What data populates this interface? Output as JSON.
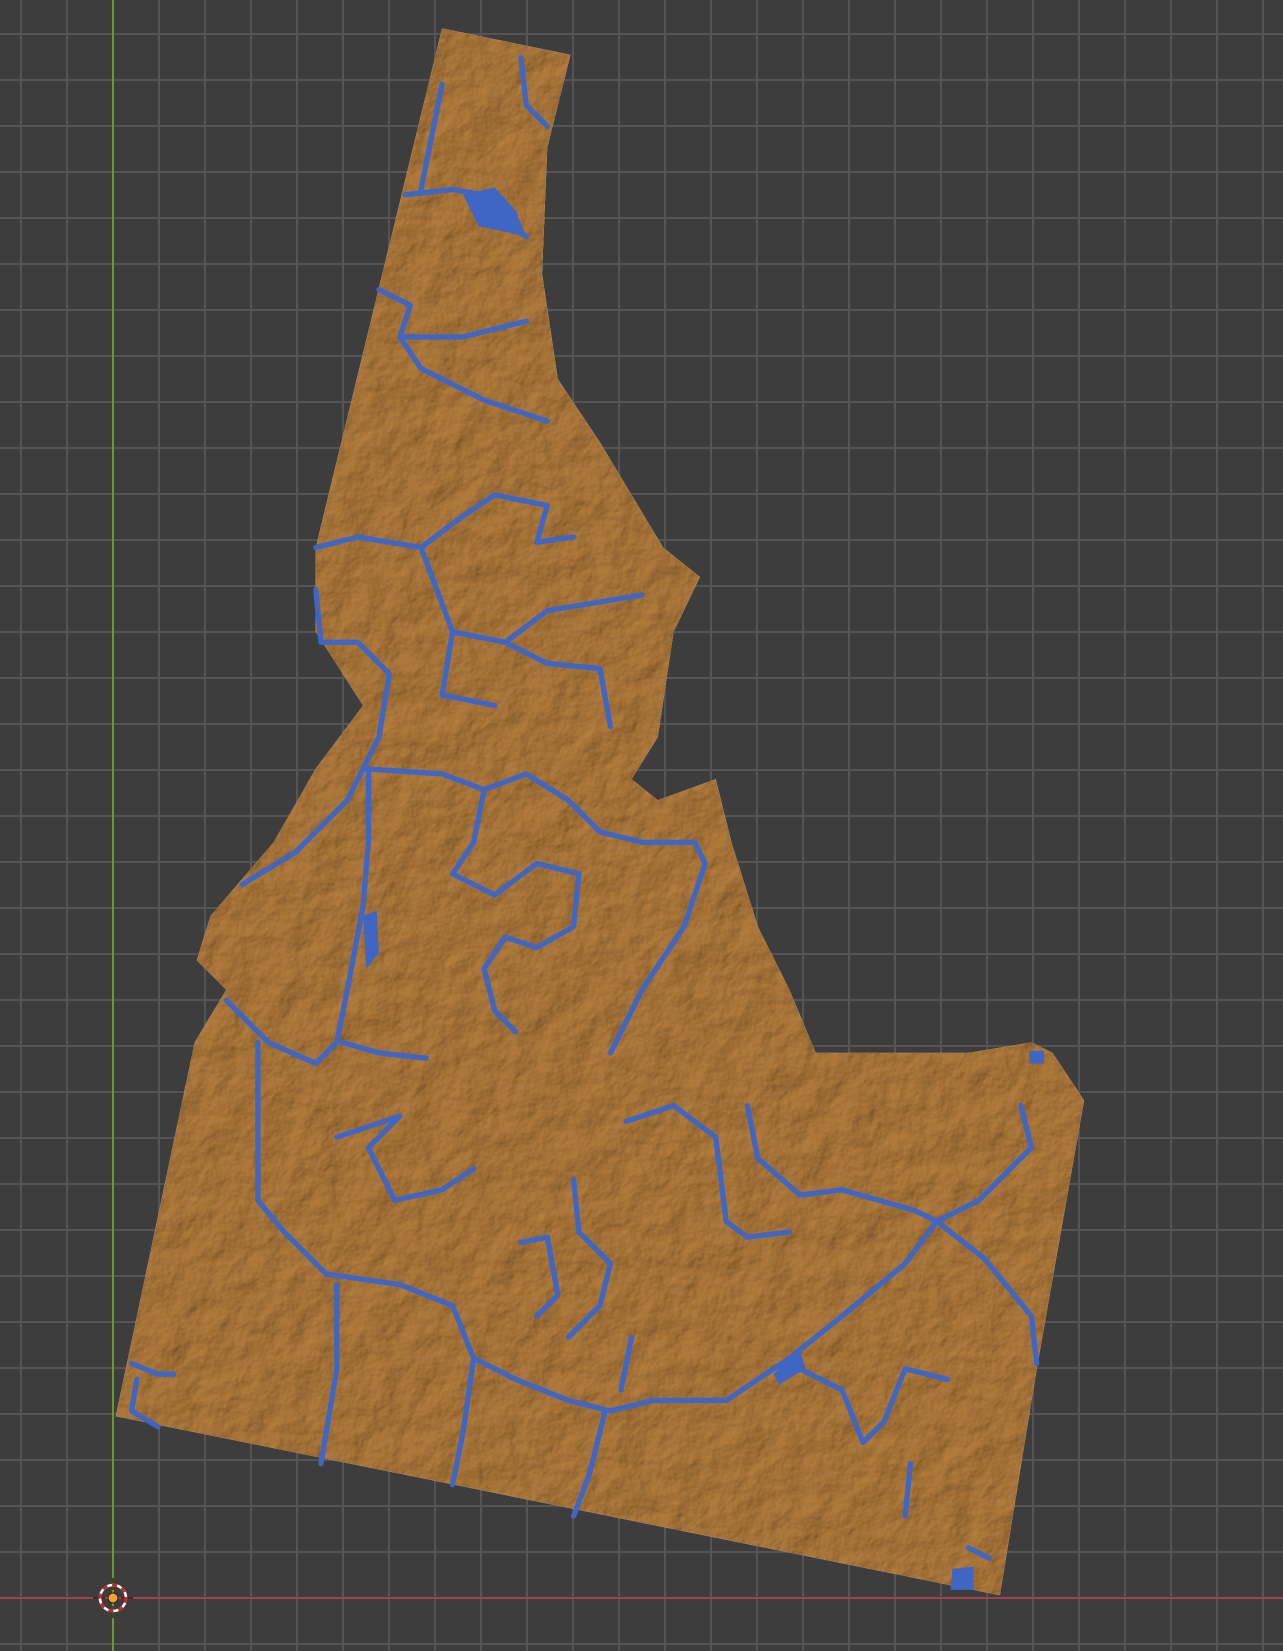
{
  "viewport": {
    "object": "idaho-relief-map",
    "colors": {
      "background": "#3d3d3d",
      "grid": "#555555",
      "terrain": "#b8803f",
      "water": "#3f66c2",
      "axis_x": "#a5404c",
      "axis_y": "#6a9a2a"
    },
    "icons": [
      "3d-cursor-icon"
    ]
  }
}
